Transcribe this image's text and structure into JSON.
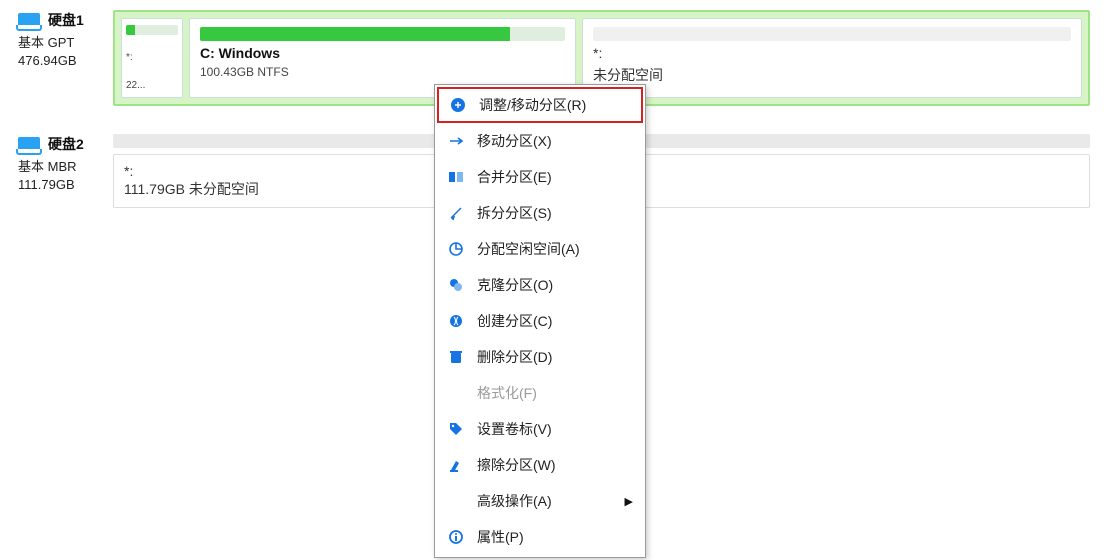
{
  "disk1": {
    "name": "硬盘1",
    "type_line": "基本 GPT",
    "size": "476.94GB",
    "small_part": {
      "symbol": "*:",
      "size": "22..."
    },
    "main_part": {
      "label": "C: Windows",
      "sub": "100.43GB NTFS"
    },
    "side_part": {
      "star": "*:",
      "label": "未分配空间"
    }
  },
  "disk2": {
    "name": "硬盘2",
    "type_line": "基本 MBR",
    "size": "111.79GB",
    "unalloc": {
      "star": "*:",
      "line": "111.79GB 未分配空间"
    }
  },
  "menu": {
    "resize": "调整/移动分区(R)",
    "move": "移动分区(X)",
    "merge": "合并分区(E)",
    "split": "拆分分区(S)",
    "allocfree": "分配空闲空间(A)",
    "clone": "克隆分区(O)",
    "create": "创建分区(C)",
    "delete": "删除分区(D)",
    "format": "格式化(F)",
    "label": "设置卷标(V)",
    "wipe": "擦除分区(W)",
    "advanced": "高级操作(A)",
    "props": "属性(P)"
  }
}
